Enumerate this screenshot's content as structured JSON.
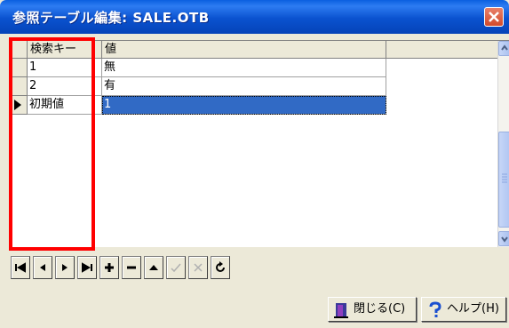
{
  "window": {
    "title": "参照テーブル編集: SALE.OTB"
  },
  "grid": {
    "headers": [
      "検索キー",
      "値"
    ],
    "rows": [
      {
        "key": "1",
        "value": "無"
      },
      {
        "key": "2",
        "value": "有"
      },
      {
        "key": "初期値",
        "value": "1"
      }
    ]
  },
  "navigator": {
    "buttons": [
      "first-icon",
      "prior-icon",
      "next-icon",
      "last-icon",
      "insert-icon",
      "delete-icon",
      "edit-icon",
      "post-icon",
      "cancel-icon",
      "refresh-icon"
    ]
  },
  "buttons": {
    "close_label": "閉じる(C)",
    "help_label": "ヘルプ(H)"
  },
  "colors": {
    "selection": "#316ac5",
    "highlight_box": "#ff0000",
    "titlebar": "#0a52cf"
  }
}
